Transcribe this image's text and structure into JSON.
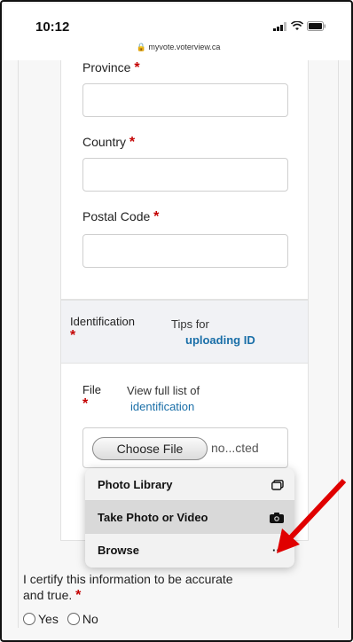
{
  "status": {
    "time": "10:12",
    "url": "myvote.voterview.ca"
  },
  "form": {
    "province_label": "Province",
    "country_label": "Country",
    "postal_label": "Postal Code",
    "required_mark": "*",
    "province_value": "",
    "country_value": "",
    "postal_value": ""
  },
  "identification": {
    "label": "Identification",
    "tips_text": "Tips for",
    "tips_link": "uploading ID"
  },
  "file": {
    "label": "File",
    "view_text": "View full list of",
    "view_link": "identification",
    "choose_button": "Choose File",
    "no_file": "no...cted"
  },
  "sheet": {
    "items": [
      {
        "label": "Photo Library",
        "icon": "photo-library-icon"
      },
      {
        "label": "Take Photo or Video",
        "icon": "camera-icon"
      },
      {
        "label": "Browse",
        "icon": "more-icon"
      }
    ],
    "more_glyph": "···"
  },
  "certify": {
    "text": "I certify this information to be accurate and true.",
    "yes": "Yes",
    "no": "No"
  },
  "colors": {
    "required": "#c40000",
    "link": "#1a6fa8",
    "arrow": "#e00000"
  }
}
